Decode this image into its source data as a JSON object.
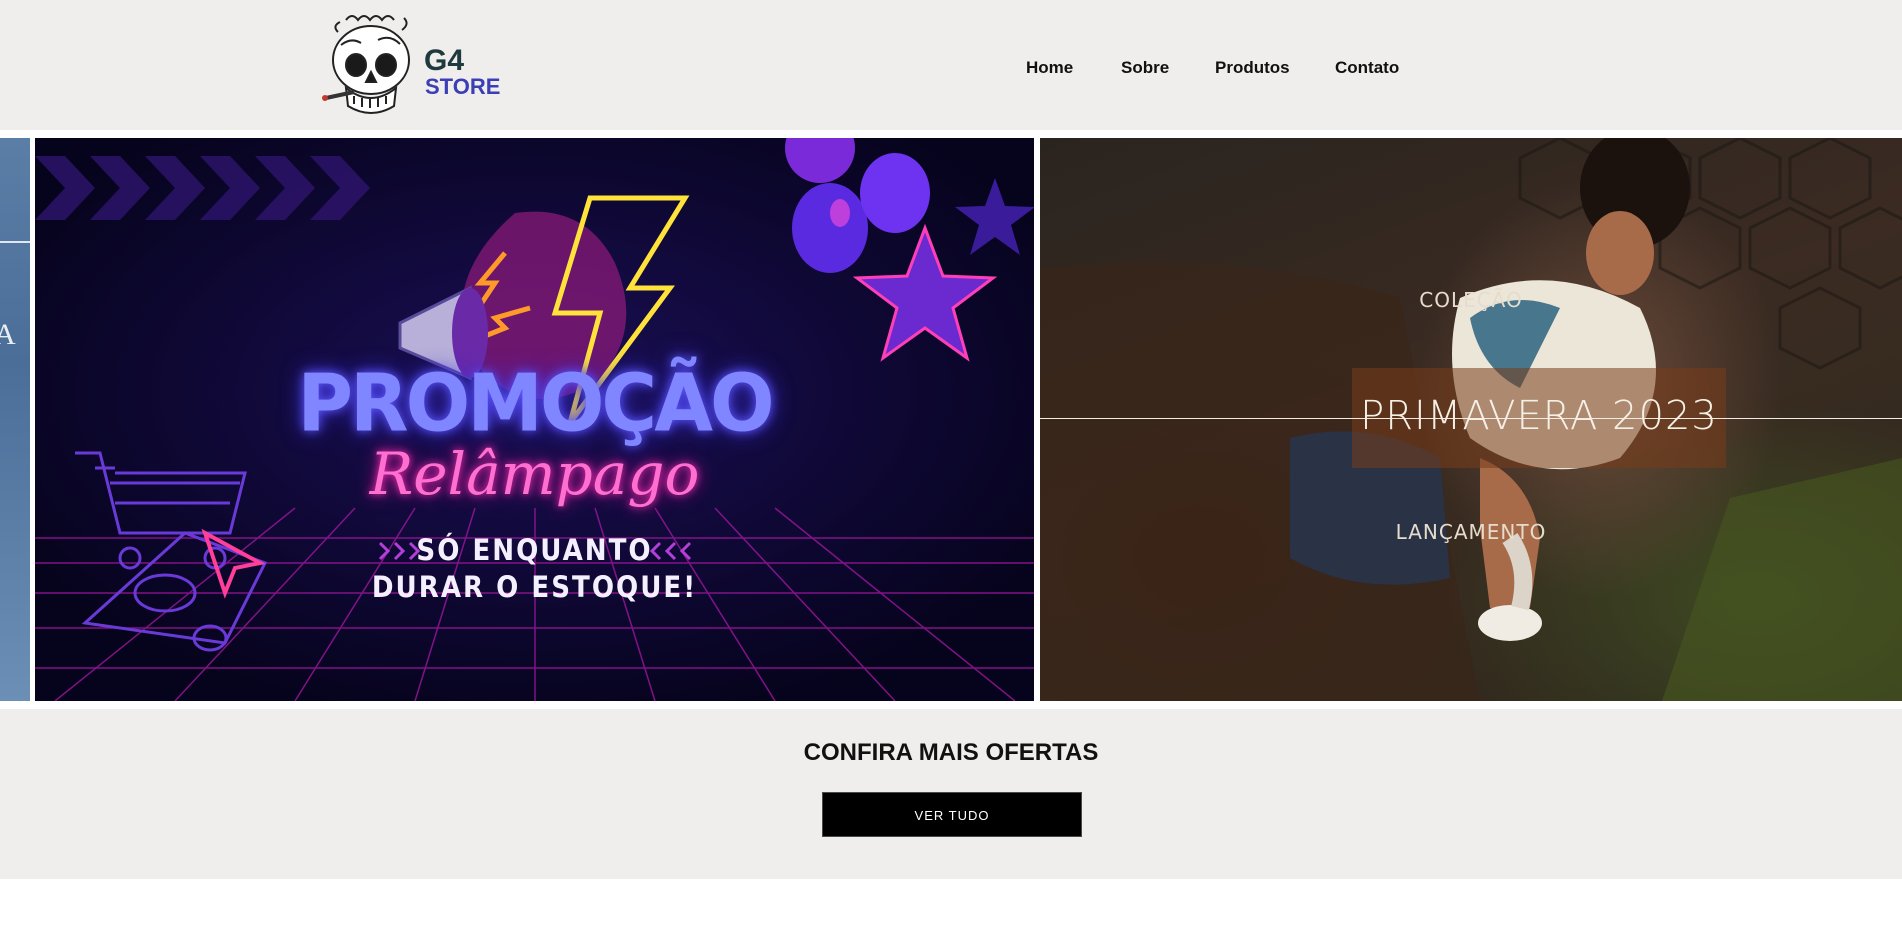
{
  "brand": {
    "line1": "G4",
    "line2": "STORE",
    "logo_icon": "skull-icon"
  },
  "nav": {
    "items": [
      {
        "label": "Home"
      },
      {
        "label": "Sobre"
      },
      {
        "label": "Produtos"
      },
      {
        "label": "Contato"
      }
    ]
  },
  "slides": {
    "left_partial": {
      "letter": "A"
    },
    "promo": {
      "title": "PROMOÇÃO",
      "subtitle": "Relâmpago",
      "line1": "SÓ ENQUANTO",
      "line2": "DURAR O ESTOQUE!"
    },
    "collection": {
      "top": "COLEÇÃO",
      "main": "PRIMAVERA 2023",
      "bottom": "LANÇAMENTO"
    }
  },
  "offers": {
    "title": "CONFIRA MAIS OFERTAS",
    "button_label": "VER TUDO"
  },
  "colors": {
    "header_bg": "#f0eeec",
    "promo_bg": "#0a0630",
    "neon_blue": "#7f86ff",
    "neon_pink": "#ff6fd0",
    "button_bg": "#000000"
  }
}
